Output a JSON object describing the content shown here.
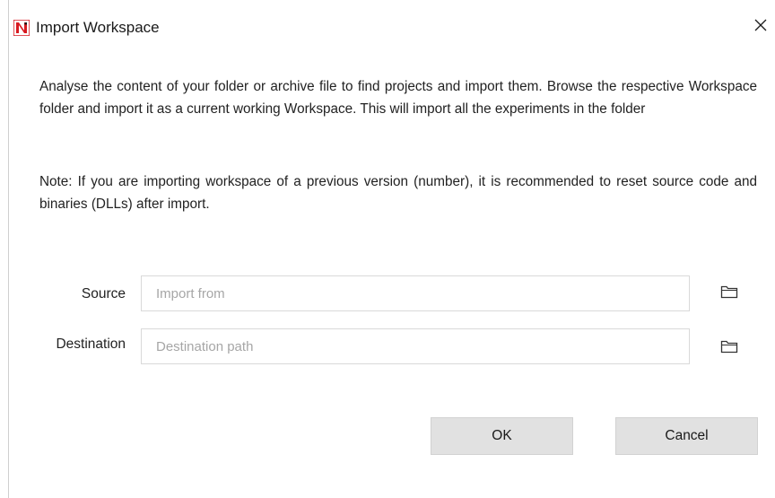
{
  "window": {
    "title": "Import Workspace",
    "logo_icon": "app-logo-icon",
    "close_icon": "close-icon",
    "accent_color": "#d71920"
  },
  "content": {
    "description": "Analyse the content of your folder or archive file to find projects and import them. Browse the respective Workspace folder and import it as a current working Workspace. This will import all the experiments in the folder",
    "note": "Note: If you are importing workspace of a previous version (number), it is recommended to reset source code and binaries (DLLs) after import."
  },
  "form": {
    "source": {
      "label": "Source",
      "value": "",
      "placeholder": "Import from",
      "browse_icon": "folder-icon"
    },
    "destination": {
      "label": "Destination",
      "value": "",
      "placeholder": "Destination path",
      "browse_icon": "folder-icon"
    }
  },
  "buttons": {
    "ok_label": "OK",
    "cancel_label": "Cancel"
  }
}
